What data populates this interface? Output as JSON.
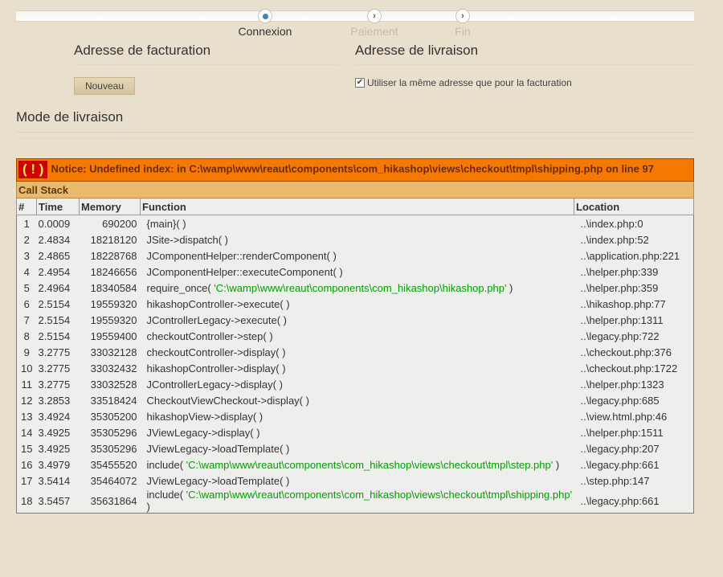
{
  "steps": [
    {
      "label": "Connexion",
      "icon": "current-dot-icon",
      "state": "active"
    },
    {
      "label": "Paiement",
      "icon": "chevron-right-icon",
      "state": "inactive"
    },
    {
      "label": "Fin",
      "icon": "chevron-right-icon",
      "state": "inactive"
    }
  ],
  "billing": {
    "title": "Adresse de facturation",
    "new_button": "Nouveau"
  },
  "shipping_address": {
    "title": "Adresse de livraison",
    "same_address_label": "Utiliser la même adresse que pour la facturation",
    "same_address_checked": true
  },
  "shipping_method": {
    "title": "Mode de livraison"
  },
  "error": {
    "icon_text": "( ! )",
    "message": "Notice: Undefined index: in C:\\wamp\\www\\reaut\\components\\com_hikashop\\views\\checkout\\tmpl\\shipping.php on line 97",
    "call_stack_label": "Call Stack",
    "columns": [
      "#",
      "Time",
      "Memory",
      "Function",
      "Location"
    ],
    "rows": [
      {
        "n": "1",
        "time": "0.0009",
        "mem": "690200",
        "func": "{main}( )",
        "arg": "",
        "func_end": "",
        "loc": "..\\index.php:0"
      },
      {
        "n": "2",
        "time": "2.4834",
        "mem": "18218120",
        "func": "JSite->dispatch( )",
        "arg": "",
        "func_end": "",
        "loc": "..\\index.php:52"
      },
      {
        "n": "3",
        "time": "2.4865",
        "mem": "18228768",
        "func": "JComponentHelper::renderComponent( )",
        "arg": "",
        "func_end": "",
        "loc": "..\\application.php:221"
      },
      {
        "n": "4",
        "time": "2.4954",
        "mem": "18246656",
        "func": "JComponentHelper::executeComponent( )",
        "arg": "",
        "func_end": "",
        "loc": "..\\helper.php:339"
      },
      {
        "n": "5",
        "time": "2.4964",
        "mem": "18340584",
        "func": "require_once( ",
        "arg": "'C:\\wamp\\www\\reaut\\components\\com_hikashop\\hikashop.php'",
        "func_end": " )",
        "loc": "..\\helper.php:359"
      },
      {
        "n": "6",
        "time": "2.5154",
        "mem": "19559320",
        "func": "hikashopController->execute( )",
        "arg": "",
        "func_end": "",
        "loc": "..\\hikashop.php:77"
      },
      {
        "n": "7",
        "time": "2.5154",
        "mem": "19559320",
        "func": "JControllerLegacy->execute( )",
        "arg": "",
        "func_end": "",
        "loc": "..\\helper.php:1311"
      },
      {
        "n": "8",
        "time": "2.5154",
        "mem": "19559400",
        "func": "checkoutController->step( )",
        "arg": "",
        "func_end": "",
        "loc": "..\\legacy.php:722"
      },
      {
        "n": "9",
        "time": "3.2775",
        "mem": "33032128",
        "func": "checkoutController->display( )",
        "arg": "",
        "func_end": "",
        "loc": "..\\checkout.php:376"
      },
      {
        "n": "10",
        "time": "3.2775",
        "mem": "33032432",
        "func": "hikashopController->display( )",
        "arg": "",
        "func_end": "",
        "loc": "..\\checkout.php:1722"
      },
      {
        "n": "11",
        "time": "3.2775",
        "mem": "33032528",
        "func": "JControllerLegacy->display( )",
        "arg": "",
        "func_end": "",
        "loc": "..\\helper.php:1323"
      },
      {
        "n": "12",
        "time": "3.2853",
        "mem": "33518424",
        "func": "CheckoutViewCheckout->display( )",
        "arg": "",
        "func_end": "",
        "loc": "..\\legacy.php:685"
      },
      {
        "n": "13",
        "time": "3.4924",
        "mem": "35305200",
        "func": "hikashopView->display( )",
        "arg": "",
        "func_end": "",
        "loc": "..\\view.html.php:46"
      },
      {
        "n": "14",
        "time": "3.4925",
        "mem": "35305296",
        "func": "JViewLegacy->display( )",
        "arg": "",
        "func_end": "",
        "loc": "..\\helper.php:1511"
      },
      {
        "n": "15",
        "time": "3.4925",
        "mem": "35305296",
        "func": "JViewLegacy->loadTemplate( )",
        "arg": "",
        "func_end": "",
        "loc": "..\\legacy.php:207"
      },
      {
        "n": "16",
        "time": "3.4979",
        "mem": "35455520",
        "func": "include( ",
        "arg": "'C:\\wamp\\www\\reaut\\components\\com_hikashop\\views\\checkout\\tmpl\\step.php'",
        "func_end": " )",
        "loc": "..\\legacy.php:661"
      },
      {
        "n": "17",
        "time": "3.5414",
        "mem": "35464072",
        "func": "JViewLegacy->loadTemplate( )",
        "arg": "",
        "func_end": "",
        "loc": "..\\step.php:147"
      },
      {
        "n": "18",
        "time": "3.5457",
        "mem": "35631864",
        "func": "include( ",
        "arg": "'C:\\wamp\\www\\reaut\\components\\com_hikashop\\views\\checkout\\tmpl\\shipping.php'",
        "func_end": " )",
        "loc": "..\\legacy.php:661"
      }
    ]
  },
  "colors": {
    "page_bg": "#e8dfcd",
    "notice_bg": "#f57900",
    "callstack_bg": "#e9b96e",
    "table_bg": "#eeeeec",
    "string_arg": "#00a000",
    "step_current": "#3a84b8"
  }
}
